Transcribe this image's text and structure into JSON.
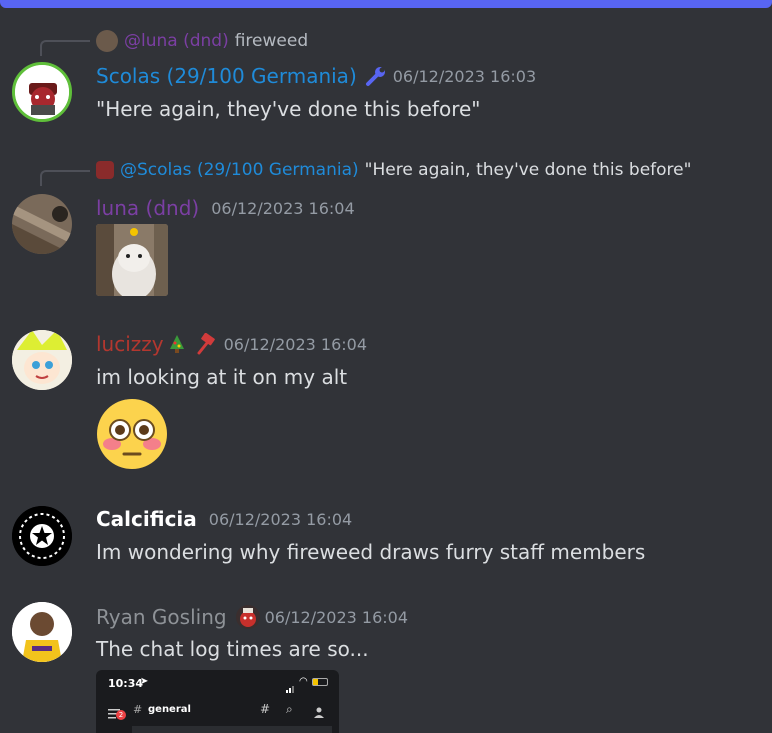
{
  "messages": [
    {
      "reply": {
        "mention": "@luna (dnd)",
        "text": "fireweed"
      },
      "author": "Scolas (29/100 Germania)",
      "timestamp": "06/12/2023 16:03",
      "text": "\"Here again, they've done this before\""
    },
    {
      "reply": {
        "mention": "@Scolas (29/100 Germania)",
        "text": "\"Here again, they've done this before\""
      },
      "author": "luna (dnd)",
      "timestamp": "06/12/2023 16:04"
    },
    {
      "author": "lucizzy",
      "timestamp": "06/12/2023 16:04",
      "text": "im looking at it on my alt"
    },
    {
      "author": "Calcificia",
      "timestamp": "06/12/2023 16:04",
      "text": "Im wondering why fireweed draws furry staff members"
    },
    {
      "author": "Ryan Gosling",
      "timestamp": "06/12/2023 16:04",
      "text": "The chat log times are so...",
      "attachment": {
        "time": "10:34",
        "channel": "general",
        "badge": "2"
      }
    }
  ],
  "colors": {
    "bg": "#313338",
    "scolas": "#1f8bd9",
    "luna": "#7b3fa3",
    "lucizzy": "#b3372f",
    "calcificia": "#ffffff",
    "ryan": "#8e9297"
  }
}
